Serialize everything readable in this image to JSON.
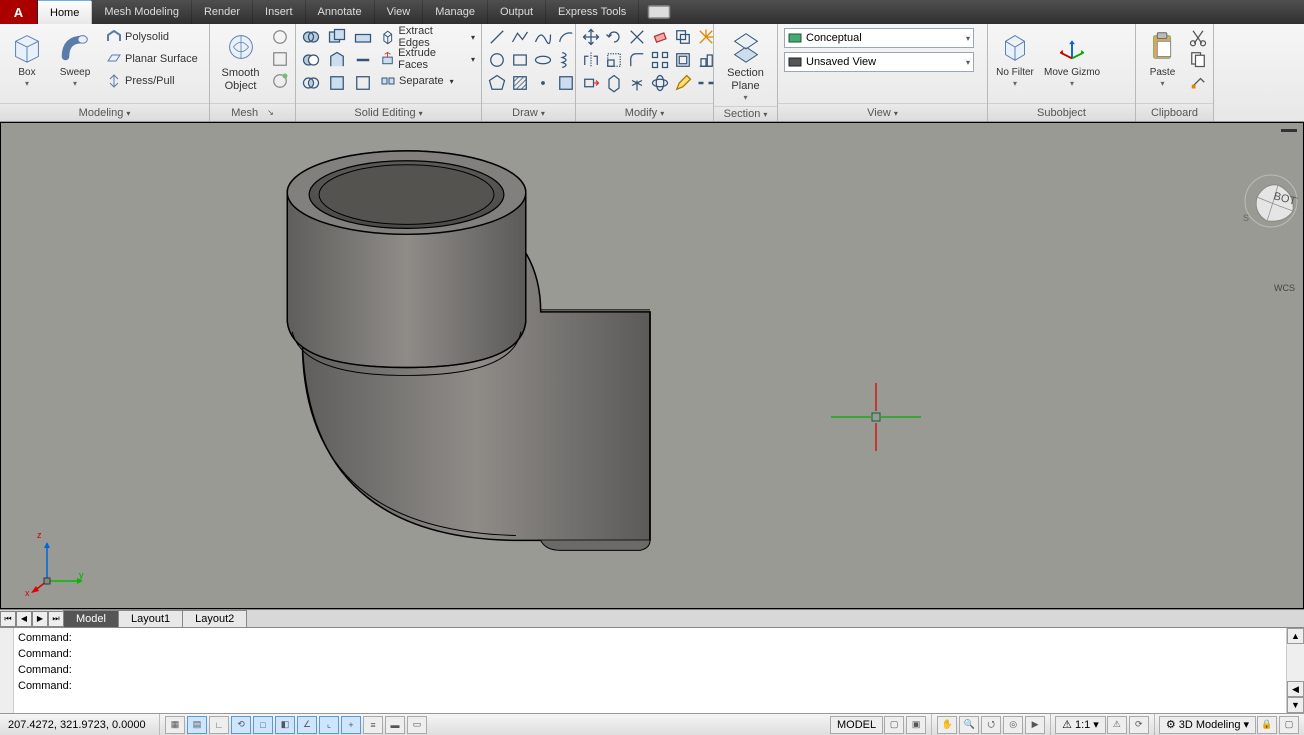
{
  "menu": {
    "tabs": [
      "Home",
      "Mesh Modeling",
      "Render",
      "Insert",
      "Annotate",
      "View",
      "Manage",
      "Output",
      "Express Tools"
    ],
    "active": 0
  },
  "ribbon": {
    "modeling": {
      "title": "Modeling",
      "box": "Box",
      "sweep": "Sweep",
      "polysolid": "Polysolid",
      "planar": "Planar Surface",
      "presspull": "Press/Pull"
    },
    "mesh": {
      "title": "Mesh",
      "smooth": "Smooth Object"
    },
    "solid_editing": {
      "title": "Solid Editing",
      "extract_edges": "Extract Edges",
      "extrude_faces": "Extrude Faces",
      "separate": "Separate"
    },
    "draw": {
      "title": "Draw"
    },
    "modify": {
      "title": "Modify"
    },
    "section": {
      "title": "Section",
      "plane": "Section Plane"
    },
    "view": {
      "title": "View",
      "visual_style": "Conceptual",
      "saved_view": "Unsaved View"
    },
    "subobject": {
      "title": "Subobject",
      "nofilter": "No Filter",
      "gizmo": "Move Gizmo"
    },
    "clipboard": {
      "title": "Clipboard",
      "paste": "Paste"
    }
  },
  "viewport": {
    "viewcube": {
      "s": "S",
      "bottom": "BOTTOM"
    },
    "wcs": "WCS",
    "axes": {
      "x": "x",
      "y": "y",
      "z": "z"
    }
  },
  "layout_tabs": [
    "Model",
    "Layout1",
    "Layout2"
  ],
  "layout_active": 0,
  "command_lines": [
    "Command:",
    "Command:",
    "Command:",
    "Command:"
  ],
  "status": {
    "coords": "207.4272, 321.9723, 0.0000",
    "model_btn": "MODEL",
    "scale": "1:1",
    "workspace": "3D Modeling"
  }
}
